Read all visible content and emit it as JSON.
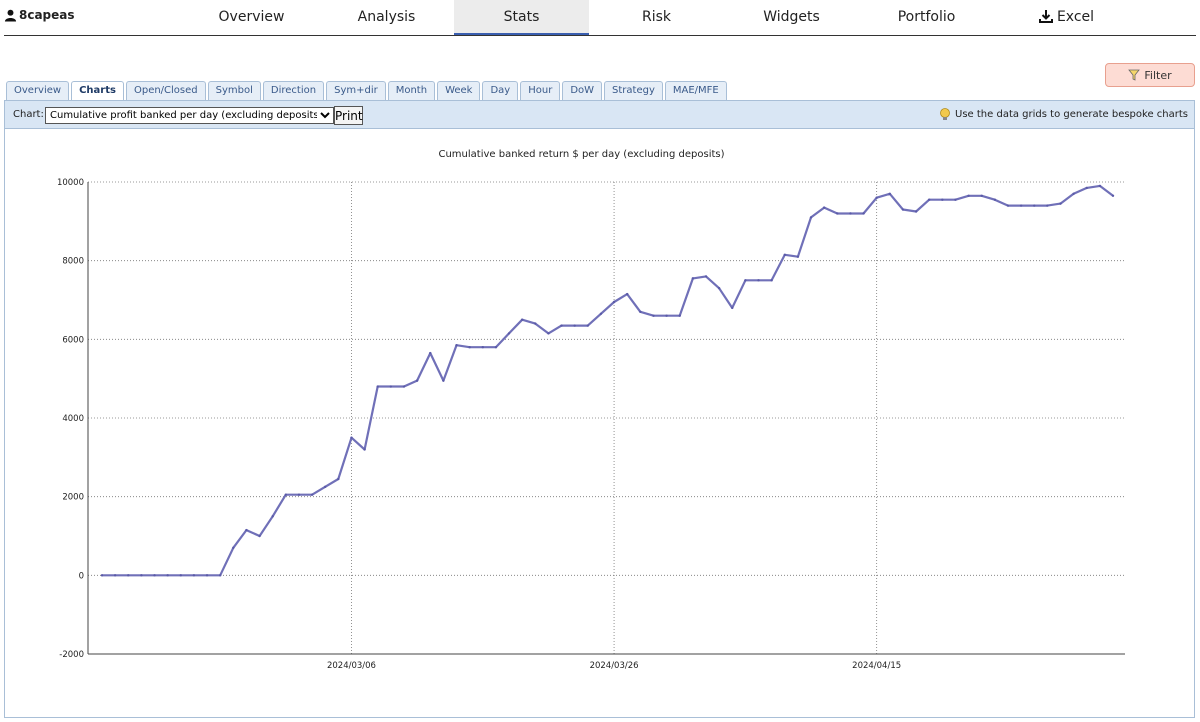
{
  "user": {
    "name": "8capeas"
  },
  "nav": {
    "items": [
      {
        "label": "Overview",
        "active": false
      },
      {
        "label": "Analysis",
        "active": false
      },
      {
        "label": "Stats",
        "active": true
      },
      {
        "label": "Risk",
        "active": false
      },
      {
        "label": "Widgets",
        "active": false
      },
      {
        "label": "Portfolio",
        "active": false
      },
      {
        "label": "Excel",
        "active": false
      }
    ]
  },
  "filter_label": "Filter",
  "tabs": [
    {
      "label": "Overview",
      "active": false
    },
    {
      "label": "Charts",
      "active": true
    },
    {
      "label": "Open/Closed",
      "active": false
    },
    {
      "label": "Symbol",
      "active": false
    },
    {
      "label": "Direction",
      "active": false
    },
    {
      "label": "Sym+dir",
      "active": false
    },
    {
      "label": "Month",
      "active": false
    },
    {
      "label": "Week",
      "active": false
    },
    {
      "label": "Day",
      "active": false
    },
    {
      "label": "Hour",
      "active": false
    },
    {
      "label": "DoW",
      "active": false
    },
    {
      "label": "Strategy",
      "active": false
    },
    {
      "label": "MAE/MFE",
      "active": false
    }
  ],
  "toolbar": {
    "chart_label": "Chart:",
    "selected_chart": "Cumulative profit banked per day (excluding deposits)",
    "print_label": "Print",
    "hint": "Use the data grids to generate bespoke charts"
  },
  "colors": {
    "line": "#7070b8",
    "accent": "#3a5fb0",
    "filter_bg": "#fddcd4"
  },
  "chart_data": {
    "type": "line",
    "title": "Cumulative banked return $ per day (excluding deposits)",
    "xlabel": "",
    "ylabel": "",
    "ylim": [
      -2000,
      10000
    ],
    "yticks": [
      -2000,
      0,
      2000,
      4000,
      6000,
      8000,
      10000
    ],
    "x_ticks": [
      {
        "label": "2024/03/06",
        "index": 19
      },
      {
        "label": "2024/03/26",
        "index": 39
      },
      {
        "label": "2024/04/15",
        "index": 59
      }
    ],
    "grid": true,
    "series": [
      {
        "values": [
          0,
          0,
          0,
          0,
          0,
          0,
          0,
          0,
          0,
          0,
          700,
          1150,
          1000,
          1500,
          2050,
          2050,
          2050,
          2250,
          2450,
          3500,
          3200,
          4800,
          4800,
          4800,
          4950,
          5650,
          4950,
          5850,
          5800,
          5800,
          5800,
          6150,
          6500,
          6400,
          6150,
          6350,
          6350,
          6350,
          6650,
          6950,
          7150,
          6700,
          6600,
          6600,
          6600,
          7550,
          7600,
          7300,
          6800,
          7500,
          7500,
          7500,
          8150,
          8100,
          9100,
          9350,
          9200,
          9200,
          9200,
          9600,
          9700,
          9300,
          9250,
          9550,
          9550,
          9550,
          9650,
          9650,
          9550,
          9400,
          9400,
          9400,
          9400,
          9450,
          9700,
          9850,
          9900,
          9650
        ]
      }
    ]
  }
}
